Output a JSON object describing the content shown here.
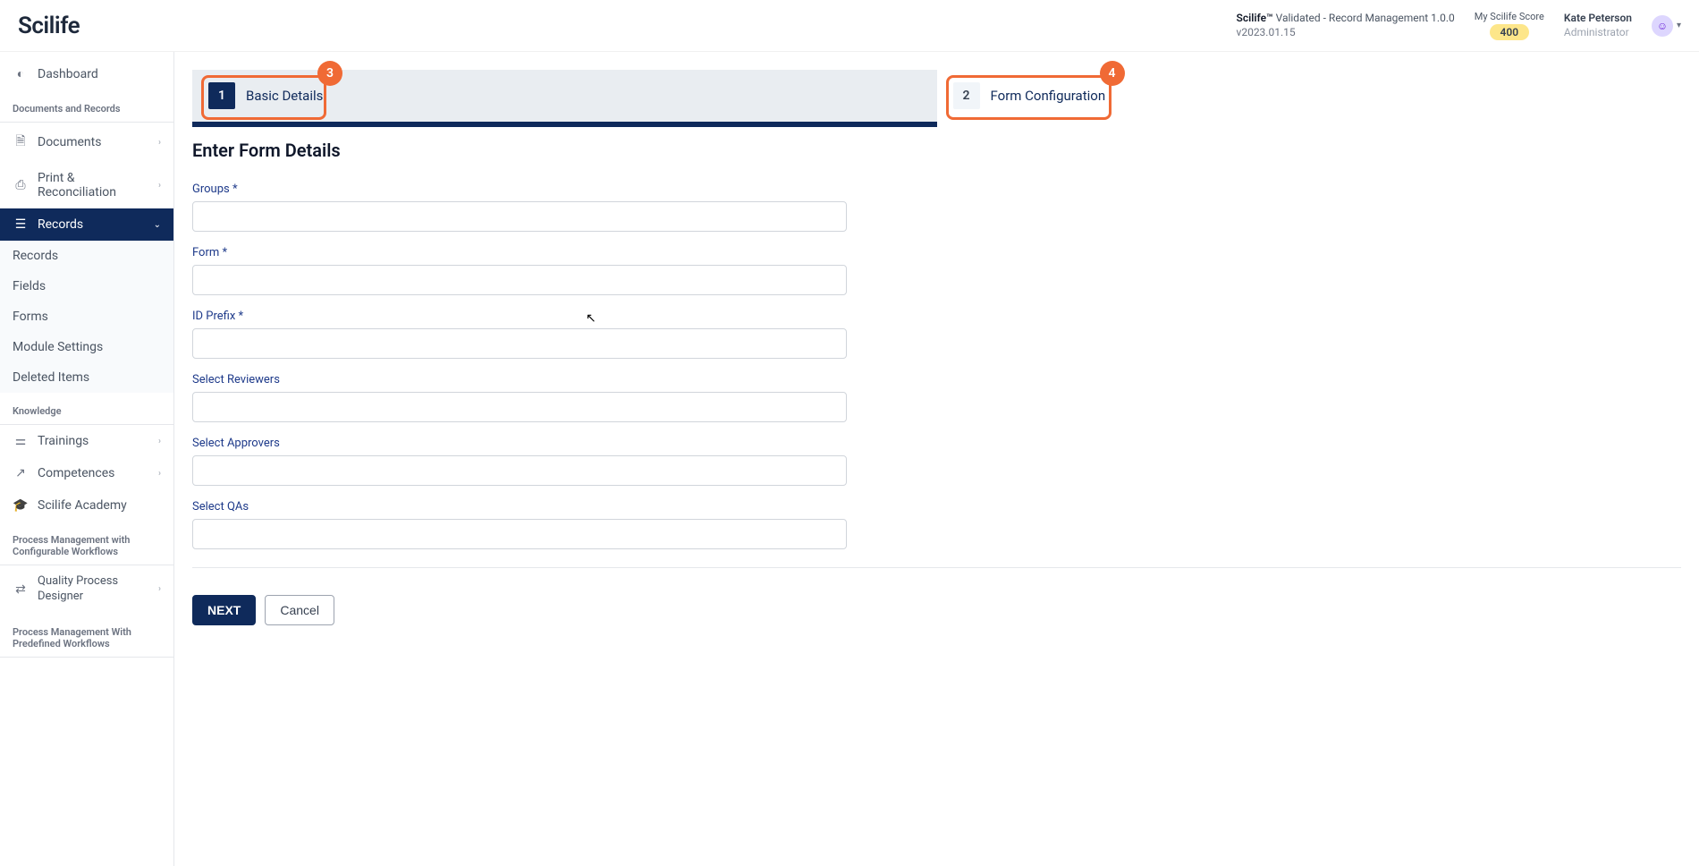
{
  "header": {
    "logo": "Scilife",
    "product_name": "Scilife™",
    "product_desc": " Validated - Record Management 1.0.0",
    "product_version": "v2023.01.15",
    "score_label": "My Scilife Score",
    "score_value": "400",
    "user_name": "Kate Peterson",
    "user_role": "Administrator"
  },
  "sidebar": {
    "dashboard": "Dashboard",
    "group_docs": "Documents and Records",
    "documents": "Documents",
    "print_recon": "Print & Reconciliation",
    "records": "Records",
    "sub_records": "Records",
    "sub_fields": "Fields",
    "sub_forms": "Forms",
    "sub_module": "Module Settings",
    "sub_deleted": "Deleted Items",
    "group_knowledge": "Knowledge",
    "trainings": "Trainings",
    "competences": "Competences",
    "academy": "Scilife Academy",
    "group_pm_config": "Process Management with Configurable Workflows",
    "qpd": "Quality Process Designer",
    "group_pm_predef": "Process Management With Predefined Workflows"
  },
  "stepper": {
    "step1_num": "1",
    "step1_label": "Basic Details",
    "step2_num": "2",
    "step2_label": "Form Configuration",
    "callout3": "3",
    "callout4": "4"
  },
  "page": {
    "title": "Enter Form Details"
  },
  "form": {
    "groups_label": "Groups *",
    "form_label": "Form *",
    "idprefix_label": "ID Prefix *",
    "reviewers_label": "Select Reviewers",
    "approvers_label": "Select Approvers",
    "qas_label": "Select QAs"
  },
  "actions": {
    "next": "NEXT",
    "cancel": "Cancel"
  }
}
